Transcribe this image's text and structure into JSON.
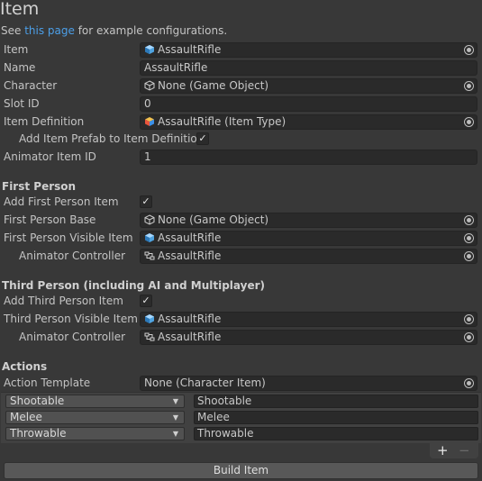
{
  "header": {
    "title": "Item",
    "see_prefix": "See ",
    "see_link": "this page",
    "see_suffix": " for example configurations."
  },
  "item_section": {
    "item_label": "Item",
    "item_value": "AssaultRifle",
    "name_label": "Name",
    "name_value": "AssaultRifle",
    "character_label": "Character",
    "character_value": "None (Game Object)",
    "slot_label": "Slot ID",
    "slot_value": "0",
    "definition_label": "Item Definition",
    "definition_value": "AssaultRifle (Item Type)",
    "add_prefab_label": "Add Item Prefab to Item Definition",
    "add_prefab_checked": true,
    "animator_id_label": "Animator Item ID",
    "animator_id_value": "1"
  },
  "first_person": {
    "header": "First Person",
    "add_label": "Add First Person Item",
    "add_checked": true,
    "base_label": "First Person Base",
    "base_value": "None (Game Object)",
    "visible_label": "First Person Visible Item",
    "visible_value": "AssaultRifle",
    "animator_label": "Animator Controller",
    "animator_value": "AssaultRifle"
  },
  "third_person": {
    "header": "Third Person (including AI and Multiplayer)",
    "add_label": "Add Third Person Item",
    "add_checked": true,
    "visible_label": "Third Person Visible Item",
    "visible_value": "AssaultRifle",
    "animator_label": "Animator Controller",
    "animator_value": "AssaultRifle"
  },
  "actions": {
    "header": "Actions",
    "template_label": "Action Template",
    "template_value": "None (Character Item)",
    "rows": [
      {
        "type": "Shootable",
        "name": "Shootable"
      },
      {
        "type": "Melee",
        "name": "Melee"
      },
      {
        "type": "Throwable",
        "name": "Throwable"
      }
    ],
    "add_symbol": "+",
    "remove_symbol": "−"
  },
  "build_button": "Build Item",
  "colors": {
    "link": "#4c9fe8",
    "background": "#383838",
    "field": "#2a2a2a"
  },
  "icons": [
    "prefab-icon",
    "gameobject-icon",
    "item-type-icon",
    "animator-controller-icon",
    "object-picker-icon",
    "checkmark-icon",
    "dropdown-arrow-icon"
  ]
}
